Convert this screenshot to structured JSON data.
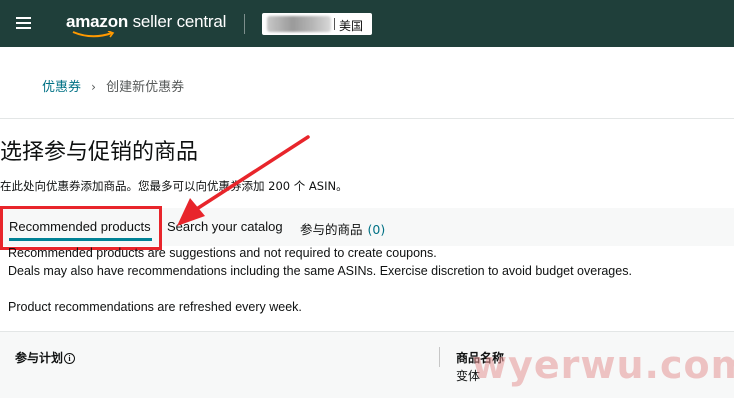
{
  "topbar": {
    "brand": "amazon",
    "product": "seller central",
    "marketplace": "美国"
  },
  "breadcrumb": {
    "parent": "优惠券",
    "separator": "›",
    "current": "创建新优惠券"
  },
  "page": {
    "title": "选择参与促销的商品",
    "subtitle": "在此处向优惠券添加商品。您最多可以向优惠券添加 200 个 ASIN。"
  },
  "tabs": [
    {
      "label": "Recommended products",
      "active": true
    },
    {
      "label": "Search your catalog",
      "active": false
    },
    {
      "label": "参与的商品",
      "count": "(0)",
      "active": false
    }
  ],
  "notes": [
    "Recommended products are suggestions and not required to create coupons.",
    "Deals may also have recommendations including the same ASINs. Exercise discretion to avoid budget overages.",
    "Product recommendations are refreshed every week."
  ],
  "table": {
    "col1": "参与计划",
    "col2": "商品名称",
    "col2_sub": "变体"
  },
  "watermark": "wyerwu.com",
  "colors": {
    "topbar": "#1f3f3a",
    "link": "#007185",
    "highlight": "#e8252b",
    "tab_underline": "#008296"
  }
}
